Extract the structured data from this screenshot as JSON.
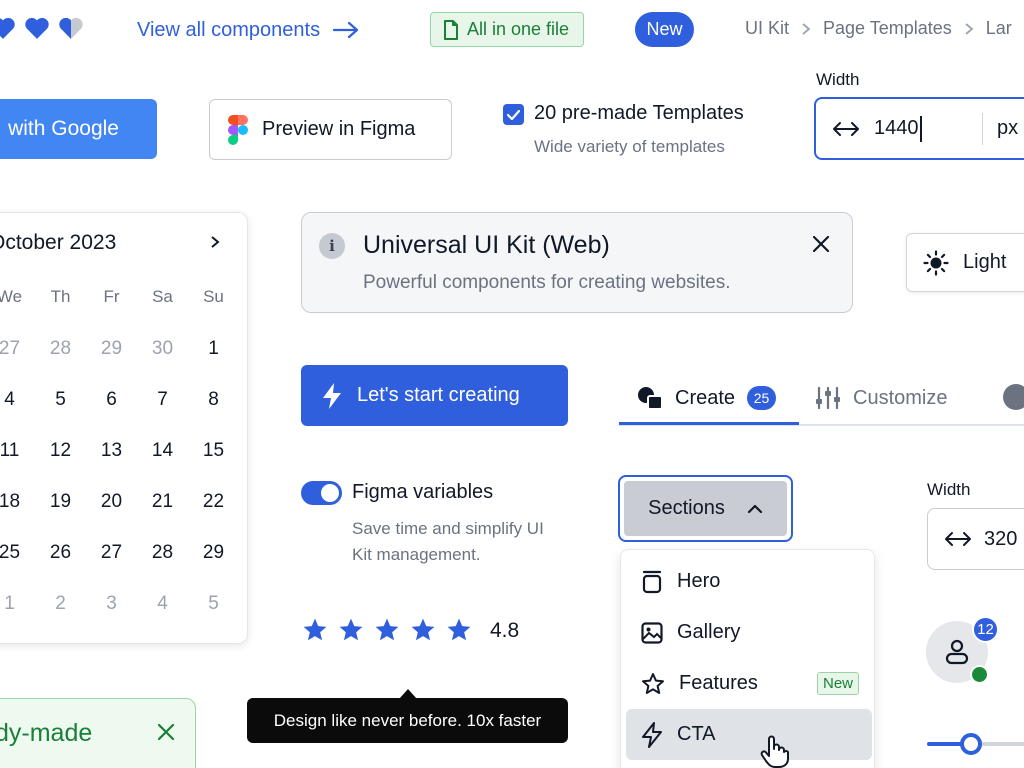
{
  "header": {
    "view_all_label": "View all components",
    "all_in_one_label": "All in one file",
    "new_pill_label": "New",
    "breadcrumbs": [
      "UI Kit",
      "Page Templates",
      "Lar"
    ]
  },
  "auth": {
    "google_label": "with Google",
    "figma_label": "Preview in Figma"
  },
  "templates": {
    "checked": true,
    "title": "20 pre-made Templates",
    "subtitle": "Wide variety of templates"
  },
  "width_field": {
    "label": "Width",
    "value": "1440",
    "unit": "px"
  },
  "calendar": {
    "month": "October 2023",
    "weekdays": [
      "We",
      "Th",
      "Fr",
      "Sa",
      "Su"
    ],
    "weeks": [
      [
        "27",
        "28",
        "29",
        "30",
        "1"
      ],
      [
        "4",
        "5",
        "6",
        "7",
        "8"
      ],
      [
        "11",
        "12",
        "13",
        "14",
        "15"
      ],
      [
        "18",
        "19",
        "20",
        "21",
        "22"
      ],
      [
        "25",
        "26",
        "27",
        "28",
        "29"
      ],
      [
        "1",
        "2",
        "3",
        "4",
        "5"
      ]
    ]
  },
  "alert": {
    "title": "Universal UI Kit (Web)",
    "subtitle": "Powerful components for creating websites."
  },
  "theme": {
    "label": "Light"
  },
  "cta": {
    "label": "Let's start creating"
  },
  "tabs": {
    "create_label": "Create",
    "create_count": "25",
    "customize_label": "Customize"
  },
  "toggle": {
    "on": true,
    "title": "Figma variables",
    "subtitle": "Save time and simplify UI Kit management."
  },
  "rating": {
    "stars": 5,
    "value": "4.8"
  },
  "tooltip": {
    "text": "Design like never before. 10x faster"
  },
  "ready": {
    "label": "dy-made"
  },
  "sections": {
    "button_label": "Sections",
    "items": [
      {
        "label": "Hero",
        "icon": "hero-icon"
      },
      {
        "label": "Gallery",
        "icon": "image-icon"
      },
      {
        "label": "Features",
        "icon": "star-icon",
        "tag": "New"
      },
      {
        "label": "CTA",
        "icon": "lightning-icon"
      }
    ]
  },
  "width_field2": {
    "label": "Width",
    "value": "320"
  },
  "avatar": {
    "badge_count": "12",
    "status": "online"
  },
  "slider": {
    "value_percent": 45
  },
  "colors": {
    "primary": "#2f5fdc",
    "google": "#4286f4",
    "success": "#1a7f37",
    "success_bg": "#e8f6ea"
  }
}
